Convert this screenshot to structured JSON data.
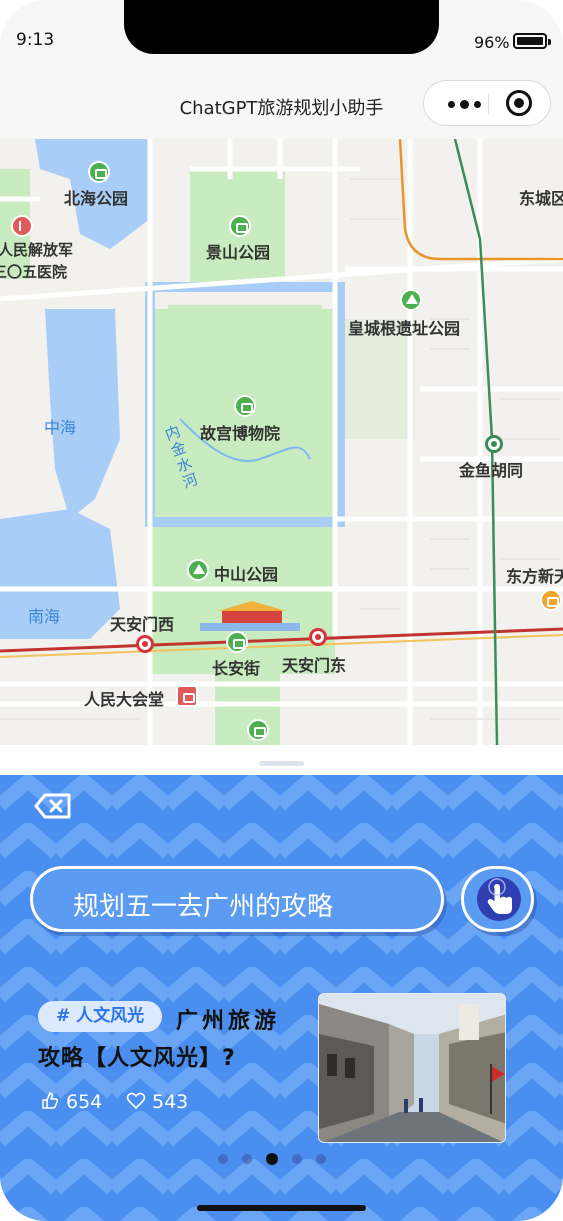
{
  "status_bar": {
    "time": "9:13",
    "battery": "96%"
  },
  "navbar": {
    "title": "ChatGPT旅游规划小助手"
  },
  "map": {
    "labels": {
      "beihai": "北海公园",
      "jingshan": "景山公园",
      "dongcheng": "东城区",
      "hospital1": "人民解放军",
      "hospital2": "三〇五医院",
      "huangcheng": "皇城根遗址公园",
      "zhonghai": "中海",
      "gugong": "故宫博物院",
      "jinshuihe": "内金水河",
      "jinyu": "金鱼胡同",
      "zhongshan": "中山公园",
      "dongfang": "东方新天",
      "nanhai": "南海",
      "tiananmen_west": "天安门西",
      "changan": "长安街",
      "tiananmen_east": "天安门东",
      "dahuitang": "人民大会堂"
    }
  },
  "panel": {
    "input_text": "规划五一去广州的攻略",
    "card": {
      "tag": "# 人文风光",
      "title_line1": "广州旅游",
      "title_line2": "攻略【人文风光】?",
      "views": "654",
      "likes": "543"
    },
    "page_count": 5,
    "active_page": 3
  },
  "colors": {
    "panel_blue": "#4a8ff0",
    "tag_bg": "#dce9ff",
    "accent": "#2a73e8"
  }
}
